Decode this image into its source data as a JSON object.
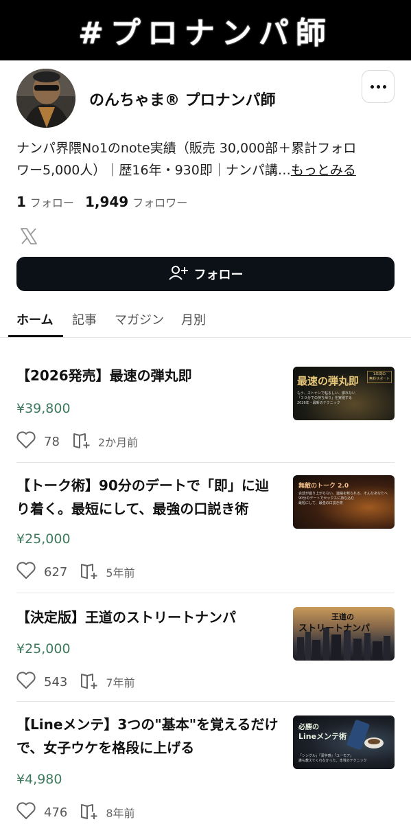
{
  "banner": {
    "title": "#プロナンパ師"
  },
  "profile": {
    "name": "のんちゃま® プロナンパ師",
    "bio_line1": "ナンパ界隈No1のnote実績（販売 30,000部＋累計フォロ",
    "bio_line2": "ワー5,000人）｜歴16年・930即｜ナンパ講…",
    "bio_more": "もっとみる",
    "follow_count": "1",
    "follow_label": "フォロー",
    "follower_count": "1,949",
    "follower_label": "フォロワー",
    "follow_button": "フォロー"
  },
  "tabs": [
    {
      "label": "ホーム",
      "active": true
    },
    {
      "label": "記事",
      "active": false
    },
    {
      "label": "マガジン",
      "active": false
    },
    {
      "label": "月別",
      "active": false
    }
  ],
  "articles": [
    {
      "title": "【2026発売】最速の弾丸即",
      "price": "¥39,800",
      "likes": "78",
      "date": "2か月前",
      "thumb_title": "最速の弾丸即",
      "thumb_badge": "1年間の\n無料サポート",
      "thumb_sub": "もう、ストナンで粘るしい、儚れない\n「３０分での持ち帰り」を実現する\n2026年・最新のテクニック"
    },
    {
      "title": "【トーク術】90分のデートで「即」に辿り着く。最短にして、最強の口説き術",
      "price": "¥25,000",
      "likes": "627",
      "date": "5年前",
      "thumb_title": "無敵のトーク 2.0",
      "thumb_sub": "会話が盛り上がらない、連絡を断られる、そんなあなたへ\n90分のデートでセックスに持ち込む\n最短にして、最強の口説き術"
    },
    {
      "title": "【決定版】王道のストリートナンパ",
      "price": "¥25,000",
      "likes": "543",
      "date": "7年前",
      "thumb_title_line1": "王道の",
      "thumb_title_line2": "ストリートナンパ"
    },
    {
      "title": "【Lineメンテ】3つの\"基本\"を覚えるだけで、女子ウケを格段に上げる",
      "price": "¥4,980",
      "likes": "476",
      "date": "8年前",
      "thumb_title_line1": "必勝の",
      "thumb_title_line2": "Lineメンテ術",
      "thumb_sub": "「シングル」「漢字感」「ユーモア」\n誰も教えてくれなかった、本当のテクニック"
    }
  ],
  "colors": {
    "price": "#3b7a5c",
    "button_bg": "#0b1117",
    "banner_bg": "#000000"
  }
}
